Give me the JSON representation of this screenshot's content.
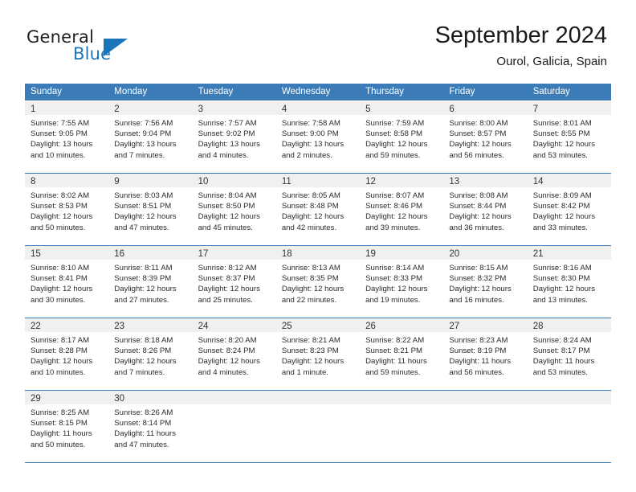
{
  "brand": {
    "name_top": "General",
    "name_bottom": "Blue",
    "accent_color": "#1b75bb",
    "triangle_icon": "blue-triangle-icon"
  },
  "header": {
    "title": "September 2024",
    "location": "Ourol, Galicia, Spain"
  },
  "theme": {
    "header_bg": "#3b7cb8",
    "header_text": "#ffffff",
    "daynum_band": "#f0f0f0",
    "grid_line": "#3b7cb8",
    "body_text": "#2b2b2b"
  },
  "calendar": {
    "weekdays": [
      "Sunday",
      "Monday",
      "Tuesday",
      "Wednesday",
      "Thursday",
      "Friday",
      "Saturday"
    ],
    "weeks": [
      [
        {
          "day": "1",
          "sunrise": "Sunrise: 7:55 AM",
          "sunset": "Sunset: 9:05 PM",
          "daylight1": "Daylight: 13 hours",
          "daylight2": "and 10 minutes."
        },
        {
          "day": "2",
          "sunrise": "Sunrise: 7:56 AM",
          "sunset": "Sunset: 9:04 PM",
          "daylight1": "Daylight: 13 hours",
          "daylight2": "and 7 minutes."
        },
        {
          "day": "3",
          "sunrise": "Sunrise: 7:57 AM",
          "sunset": "Sunset: 9:02 PM",
          "daylight1": "Daylight: 13 hours",
          "daylight2": "and 4 minutes."
        },
        {
          "day": "4",
          "sunrise": "Sunrise: 7:58 AM",
          "sunset": "Sunset: 9:00 PM",
          "daylight1": "Daylight: 13 hours",
          "daylight2": "and 2 minutes."
        },
        {
          "day": "5",
          "sunrise": "Sunrise: 7:59 AM",
          "sunset": "Sunset: 8:58 PM",
          "daylight1": "Daylight: 12 hours",
          "daylight2": "and 59 minutes."
        },
        {
          "day": "6",
          "sunrise": "Sunrise: 8:00 AM",
          "sunset": "Sunset: 8:57 PM",
          "daylight1": "Daylight: 12 hours",
          "daylight2": "and 56 minutes."
        },
        {
          "day": "7",
          "sunrise": "Sunrise: 8:01 AM",
          "sunset": "Sunset: 8:55 PM",
          "daylight1": "Daylight: 12 hours",
          "daylight2": "and 53 minutes."
        }
      ],
      [
        {
          "day": "8",
          "sunrise": "Sunrise: 8:02 AM",
          "sunset": "Sunset: 8:53 PM",
          "daylight1": "Daylight: 12 hours",
          "daylight2": "and 50 minutes."
        },
        {
          "day": "9",
          "sunrise": "Sunrise: 8:03 AM",
          "sunset": "Sunset: 8:51 PM",
          "daylight1": "Daylight: 12 hours",
          "daylight2": "and 47 minutes."
        },
        {
          "day": "10",
          "sunrise": "Sunrise: 8:04 AM",
          "sunset": "Sunset: 8:50 PM",
          "daylight1": "Daylight: 12 hours",
          "daylight2": "and 45 minutes."
        },
        {
          "day": "11",
          "sunrise": "Sunrise: 8:05 AM",
          "sunset": "Sunset: 8:48 PM",
          "daylight1": "Daylight: 12 hours",
          "daylight2": "and 42 minutes."
        },
        {
          "day": "12",
          "sunrise": "Sunrise: 8:07 AM",
          "sunset": "Sunset: 8:46 PM",
          "daylight1": "Daylight: 12 hours",
          "daylight2": "and 39 minutes."
        },
        {
          "day": "13",
          "sunrise": "Sunrise: 8:08 AM",
          "sunset": "Sunset: 8:44 PM",
          "daylight1": "Daylight: 12 hours",
          "daylight2": "and 36 minutes."
        },
        {
          "day": "14",
          "sunrise": "Sunrise: 8:09 AM",
          "sunset": "Sunset: 8:42 PM",
          "daylight1": "Daylight: 12 hours",
          "daylight2": "and 33 minutes."
        }
      ],
      [
        {
          "day": "15",
          "sunrise": "Sunrise: 8:10 AM",
          "sunset": "Sunset: 8:41 PM",
          "daylight1": "Daylight: 12 hours",
          "daylight2": "and 30 minutes."
        },
        {
          "day": "16",
          "sunrise": "Sunrise: 8:11 AM",
          "sunset": "Sunset: 8:39 PM",
          "daylight1": "Daylight: 12 hours",
          "daylight2": "and 27 minutes."
        },
        {
          "day": "17",
          "sunrise": "Sunrise: 8:12 AM",
          "sunset": "Sunset: 8:37 PM",
          "daylight1": "Daylight: 12 hours",
          "daylight2": "and 25 minutes."
        },
        {
          "day": "18",
          "sunrise": "Sunrise: 8:13 AM",
          "sunset": "Sunset: 8:35 PM",
          "daylight1": "Daylight: 12 hours",
          "daylight2": "and 22 minutes."
        },
        {
          "day": "19",
          "sunrise": "Sunrise: 8:14 AM",
          "sunset": "Sunset: 8:33 PM",
          "daylight1": "Daylight: 12 hours",
          "daylight2": "and 19 minutes."
        },
        {
          "day": "20",
          "sunrise": "Sunrise: 8:15 AM",
          "sunset": "Sunset: 8:32 PM",
          "daylight1": "Daylight: 12 hours",
          "daylight2": "and 16 minutes."
        },
        {
          "day": "21",
          "sunrise": "Sunrise: 8:16 AM",
          "sunset": "Sunset: 8:30 PM",
          "daylight1": "Daylight: 12 hours",
          "daylight2": "and 13 minutes."
        }
      ],
      [
        {
          "day": "22",
          "sunrise": "Sunrise: 8:17 AM",
          "sunset": "Sunset: 8:28 PM",
          "daylight1": "Daylight: 12 hours",
          "daylight2": "and 10 minutes."
        },
        {
          "day": "23",
          "sunrise": "Sunrise: 8:18 AM",
          "sunset": "Sunset: 8:26 PM",
          "daylight1": "Daylight: 12 hours",
          "daylight2": "and 7 minutes."
        },
        {
          "day": "24",
          "sunrise": "Sunrise: 8:20 AM",
          "sunset": "Sunset: 8:24 PM",
          "daylight1": "Daylight: 12 hours",
          "daylight2": "and 4 minutes."
        },
        {
          "day": "25",
          "sunrise": "Sunrise: 8:21 AM",
          "sunset": "Sunset: 8:23 PM",
          "daylight1": "Daylight: 12 hours",
          "daylight2": "and 1 minute."
        },
        {
          "day": "26",
          "sunrise": "Sunrise: 8:22 AM",
          "sunset": "Sunset: 8:21 PM",
          "daylight1": "Daylight: 11 hours",
          "daylight2": "and 59 minutes."
        },
        {
          "day": "27",
          "sunrise": "Sunrise: 8:23 AM",
          "sunset": "Sunset: 8:19 PM",
          "daylight1": "Daylight: 11 hours",
          "daylight2": "and 56 minutes."
        },
        {
          "day": "28",
          "sunrise": "Sunrise: 8:24 AM",
          "sunset": "Sunset: 8:17 PM",
          "daylight1": "Daylight: 11 hours",
          "daylight2": "and 53 minutes."
        }
      ],
      [
        {
          "day": "29",
          "sunrise": "Sunrise: 8:25 AM",
          "sunset": "Sunset: 8:15 PM",
          "daylight1": "Daylight: 11 hours",
          "daylight2": "and 50 minutes."
        },
        {
          "day": "30",
          "sunrise": "Sunrise: 8:26 AM",
          "sunset": "Sunset: 8:14 PM",
          "daylight1": "Daylight: 11 hours",
          "daylight2": "and 47 minutes."
        },
        {
          "day": "",
          "sunrise": "",
          "sunset": "",
          "daylight1": "",
          "daylight2": ""
        },
        {
          "day": "",
          "sunrise": "",
          "sunset": "",
          "daylight1": "",
          "daylight2": ""
        },
        {
          "day": "",
          "sunrise": "",
          "sunset": "",
          "daylight1": "",
          "daylight2": ""
        },
        {
          "day": "",
          "sunrise": "",
          "sunset": "",
          "daylight1": "",
          "daylight2": ""
        },
        {
          "day": "",
          "sunrise": "",
          "sunset": "",
          "daylight1": "",
          "daylight2": ""
        }
      ]
    ]
  }
}
